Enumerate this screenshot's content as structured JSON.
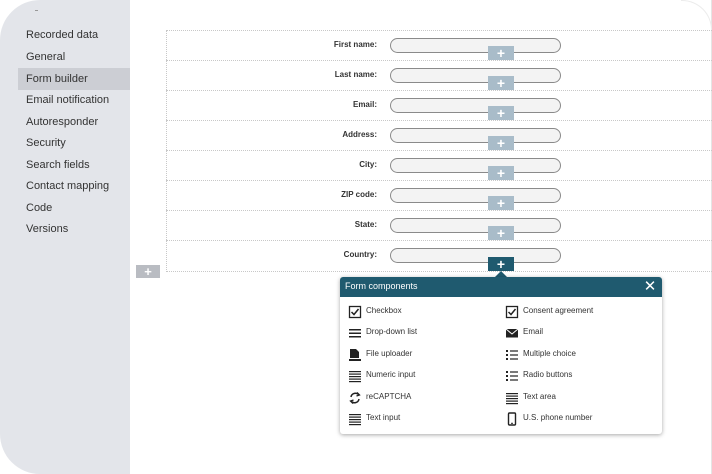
{
  "sidebar": {
    "items": [
      {
        "label": "Recorded data",
        "active": false
      },
      {
        "label": "General",
        "active": false
      },
      {
        "label": "Form builder",
        "active": true
      },
      {
        "label": "Email notification",
        "active": false
      },
      {
        "label": "Autoresponder",
        "active": false
      },
      {
        "label": "Security",
        "active": false
      },
      {
        "label": "Search fields",
        "active": false
      },
      {
        "label": "Contact mapping",
        "active": false
      },
      {
        "label": "Code",
        "active": false
      },
      {
        "label": "Versions",
        "active": false
      }
    ]
  },
  "form": {
    "fields": [
      {
        "label": "First name:"
      },
      {
        "label": "Last name:"
      },
      {
        "label": "Email:"
      },
      {
        "label": "Address:"
      },
      {
        "label": "City:"
      },
      {
        "label": "ZIP code:"
      },
      {
        "label": "State:"
      },
      {
        "label": "Country:"
      }
    ],
    "add_icon": "plus-icon",
    "add_symbol": "+"
  },
  "popup": {
    "title": "Form components",
    "close_symbol": "✕",
    "left_column": [
      {
        "label": "Checkbox",
        "icon": "checkbox-icon"
      },
      {
        "label": "Drop-down list",
        "icon": "dropdown-list-icon"
      },
      {
        "label": "File uploader",
        "icon": "file-upload-icon"
      },
      {
        "label": "Numeric input",
        "icon": "numeric-input-icon"
      },
      {
        "label": "reCAPTCHA",
        "icon": "recaptcha-icon"
      },
      {
        "label": "Text input",
        "icon": "text-input-icon"
      }
    ],
    "right_column": [
      {
        "label": "Consent agreement",
        "icon": "checkbox-icon"
      },
      {
        "label": "Email",
        "icon": "envelope-icon"
      },
      {
        "label": "Multiple choice",
        "icon": "list-icon"
      },
      {
        "label": "Radio buttons",
        "icon": "list-icon"
      },
      {
        "label": "Text area",
        "icon": "text-area-icon"
      },
      {
        "label": "U.S. phone number",
        "icon": "phone-icon"
      }
    ]
  },
  "colors": {
    "accent": "#1f5a6f",
    "add_button_inactive": "#a9bcc9",
    "sidebar_bg": "#e3e5ea",
    "sidebar_active": "#ccced4"
  }
}
